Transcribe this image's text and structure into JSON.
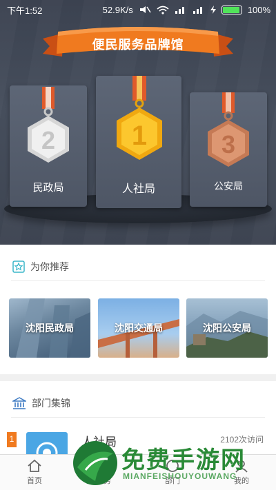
{
  "status_bar": {
    "time": "下午1:52",
    "speed": "52.9K/s",
    "battery": "100%"
  },
  "hero": {
    "banner": "便民服务品牌馆",
    "podium": [
      {
        "rank": "2",
        "name": "民政局",
        "medal": "silver"
      },
      {
        "rank": "1",
        "name": "人社局",
        "medal": "gold"
      },
      {
        "rank": "3",
        "name": "公安局",
        "medal": "bronze"
      }
    ]
  },
  "recommend": {
    "title": "为你推荐",
    "icon": "star-badge-icon",
    "tiles": [
      {
        "label": "沈阳民政局"
      },
      {
        "label": "沈阳交通局"
      },
      {
        "label": "沈阳公安局"
      }
    ]
  },
  "departments": {
    "title": "部门集锦",
    "icon": "government-building-icon",
    "items": [
      {
        "rank": "1",
        "name": "人社局",
        "visits": "2102次访问"
      }
    ]
  },
  "bottom_nav": [
    {
      "label": "首页",
      "icon": "home-icon"
    },
    {
      "label": "服务",
      "icon": "service-icon"
    },
    {
      "label": "部门",
      "icon": "department-icon"
    },
    {
      "label": "我的",
      "icon": "user-icon"
    }
  ],
  "watermark": {
    "title": "免费手游网",
    "subtitle": "MIANFEISHOUYOUWANG"
  },
  "colors": {
    "accent": "#f07a1f",
    "gold": "#f5b81c",
    "silver": "#d9d9d9",
    "bronze": "#d48a64",
    "watermark": "#2a8a37"
  }
}
